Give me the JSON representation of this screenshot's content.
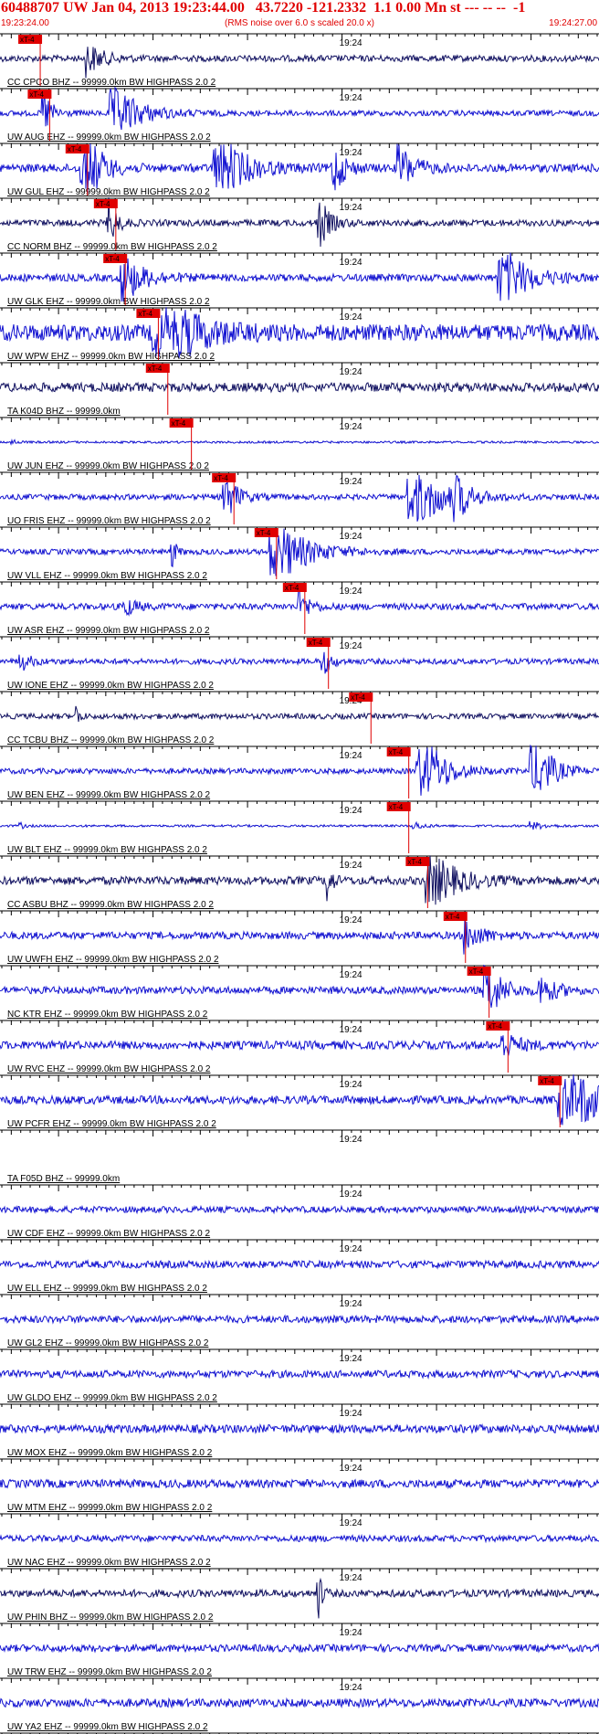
{
  "header": {
    "title": "60488707 UW Jan 04, 2013 19:23:44.00   43.7220 -121.2332  1.1 0.00 Mn st --- -- --  -1",
    "start_time": "19:23:24.00",
    "note": "(RMS noise over 6.0 s scaled 20.0 x)",
    "end_time": "19:24:27.00"
  },
  "chart_data": {
    "type": "line",
    "time_axis": {
      "start": "19:23:24.00",
      "end": "19:24:27.00",
      "tick_label": "19:24"
    },
    "pick_label": "xT-4",
    "series": [
      {
        "name": "CC CPCO BHZ -- 99999.0km BW  HIGHPASS  2.0  2",
        "color": "#101060",
        "amp": 0.35,
        "pick": "19:23:27.0",
        "events": [
          [
            "19:23:33.0",
            1.3,
            1.5
          ]
        ]
      },
      {
        "name": "UW AUG EHZ -- 99999.0km BW  HIGHPASS  2.0  2",
        "color": "#1010d0",
        "amp": 0.3,
        "pick": "19:23:28.0",
        "events": [
          [
            "19:23:28.2",
            3.0,
            0.8
          ],
          [
            "19:23:35.5",
            3.0,
            2.5
          ]
        ]
      },
      {
        "name": "UW GUL EHZ -- 99999.0km BW  HIGHPASS  2.0  2",
        "color": "#1010d0",
        "amp": 0.45,
        "pick": "19:23:32.0",
        "events": [
          [
            "19:23:32.5",
            3.2,
            1.5
          ],
          [
            "19:23:46.5",
            2.5,
            2.5
          ],
          [
            "19:23:59.0",
            2.0,
            1.0
          ],
          [
            "19:24:06.0",
            1.5,
            1.5
          ]
        ]
      },
      {
        "name": "CC NORM BHZ -- 99999.0km BW  HIGHPASS  2.0  2",
        "color": "#101060",
        "amp": 0.35,
        "pick": "19:23:35.0",
        "events": [
          [
            "19:23:35.3",
            1.8,
            0.8
          ],
          [
            "19:23:57.5",
            2.2,
            1.0
          ]
        ]
      },
      {
        "name": "UW GLK EHZ -- 99999.0km BW  HIGHPASS  2.0  2",
        "color": "#1010d0",
        "amp": 0.4,
        "pick": "19:23:36.0",
        "events": [
          [
            "19:23:36.5",
            2.0,
            2.0
          ],
          [
            "19:24:16.5",
            2.5,
            2.5
          ]
        ]
      },
      {
        "name": "UW WPW EHZ -- 99999.0km BW  HIGHPASS  2.0  2",
        "color": "#1010d0",
        "amp": 0.9,
        "pick": "19:23:39.5",
        "events": [
          [
            "19:23:40.0",
            1.8,
            3.0
          ]
        ]
      },
      {
        "name": "TA K04D BHZ -- 99999.0km",
        "color": "#101060",
        "amp": 0.5,
        "pick": "19:23:40.5",
        "events": []
      },
      {
        "name": "UW JUN EHZ -- 99999.0km BW  HIGHPASS  2.0  2",
        "color": "#1010d0",
        "amp": 0.12,
        "pick": "19:23:43.0",
        "events": [
          [
            "19:23:25.0",
            0.6,
            0.6
          ]
        ]
      },
      {
        "name": "UO FRIS EHZ -- 99999.0km BW  HIGHPASS  2.0  2",
        "color": "#1010d0",
        "amp": 0.3,
        "pick": "19:23:47.5",
        "events": [
          [
            "19:23:47.5",
            2.5,
            1.2
          ],
          [
            "19:24:07.0",
            3.8,
            3.0
          ],
          [
            "19:24:12.0",
            2.5,
            1.5
          ]
        ]
      },
      {
        "name": "UW VLL EHZ -- 99999.0km BW  HIGHPASS  2.0  2",
        "color": "#1010d0",
        "amp": 0.3,
        "pick": "19:23:52.0",
        "events": [
          [
            "19:23:52.5",
            3.5,
            3.0
          ],
          [
            "19:23:42.0",
            1.5,
            0.4
          ]
        ]
      },
      {
        "name": "UW ASR EHZ -- 99999.0km BW  HIGHPASS  2.0  2",
        "color": "#1010d0",
        "amp": 0.35,
        "pick": "19:23:55.0",
        "events": [
          [
            "19:23:55.5",
            1.2,
            1.0
          ],
          [
            "19:23:37.0",
            0.8,
            1.0
          ]
        ]
      },
      {
        "name": "UW IONE EHZ -- 99999.0km BW  HIGHPASS  2.0  2",
        "color": "#1010d0",
        "amp": 0.3,
        "pick": "19:23:57.5",
        "events": [
          [
            "19:23:58.0",
            1.2,
            0.8
          ],
          [
            "19:23:26.0",
            0.8,
            1.0
          ]
        ]
      },
      {
        "name": "CC TCBU BHZ -- 99999.0km BW  HIGHPASS  2.0  2",
        "color": "#101060",
        "amp": 0.3,
        "pick": "19:24:02.0",
        "events": [
          [
            "19:23:32.0",
            1.0,
            0.3
          ]
        ]
      },
      {
        "name": "UW BEN EHZ -- 99999.0km BW  HIGHPASS  2.0  2",
        "color": "#1010d0",
        "amp": 0.3,
        "pick": "19:24:06.0",
        "events": [
          [
            "19:24:08.0",
            5.0,
            2.0
          ],
          [
            "19:24:20.0",
            5.0,
            1.5
          ]
        ]
      },
      {
        "name": "UW BLT EHZ -- 99999.0km BW  HIGHPASS  2.0  2",
        "color": "#1010d0",
        "amp": 0.12,
        "pick": "19:24:06.0",
        "events": [
          [
            "19:24:07.5",
            1.0,
            1.0
          ],
          [
            "19:24:20.0",
            0.9,
            1.5
          ],
          [
            "19:23:26.0",
            0.6,
            0.5
          ]
        ]
      },
      {
        "name": "CC ASBU BHZ -- 99999.0km BW  HIGHPASS  2.0  2",
        "color": "#101060",
        "amp": 0.45,
        "pick": "19:24:08.0",
        "events": [
          [
            "19:24:09.0",
            2.0,
            2.5
          ],
          [
            "19:23:58.5",
            1.5,
            0.4
          ]
        ]
      },
      {
        "name": "UW UWFH EHZ -- 99999.0km BW  HIGHPASS  2.0  2",
        "color": "#1010d0",
        "amp": 0.4,
        "pick": "19:24:12.0",
        "events": [
          [
            "19:24:13.0",
            1.2,
            1.5
          ]
        ]
      },
      {
        "name": "NC KTR EHZ -- 99999.0km BW  HIGHPASS  2.0  2",
        "color": "#1010d0",
        "amp": 0.4,
        "pick": "19:24:14.5",
        "events": [
          [
            "19:24:15.0",
            2.5,
            1.5
          ],
          [
            "19:24:21.0",
            1.0,
            1.5
          ]
        ]
      },
      {
        "name": "UW RVC EHZ -- 99999.0km BW  HIGHPASS  2.0  2",
        "color": "#1010d0",
        "amp": 0.45,
        "pick": "19:24:16.5",
        "events": [
          [
            "19:24:17.0",
            0.8,
            1.5
          ]
        ]
      },
      {
        "name": "UW PCFR EHZ -- 99999.0km BW  HIGHPASS  2.0  2",
        "color": "#1010d0",
        "amp": 0.45,
        "pick": "19:24:22.0",
        "events": [
          [
            "19:24:23.0",
            3.2,
            3.0
          ]
        ]
      },
      {
        "name": "TA F05D BHZ -- 99999.0km",
        "color": "#101060",
        "amp": 0,
        "pick": null,
        "events": []
      },
      {
        "name": "UW CDF EHZ -- 99999.0km BW  HIGHPASS  2.0  2",
        "color": "#1010d0",
        "amp": 0.35,
        "pick": null,
        "events": []
      },
      {
        "name": "UW ELL EHZ -- 99999.0km BW  HIGHPASS  2.0  2",
        "color": "#1010d0",
        "amp": 0.4,
        "pick": null,
        "events": []
      },
      {
        "name": "UW GL2 EHZ -- 99999.0km BW  HIGHPASS  2.0  2",
        "color": "#1010d0",
        "amp": 0.4,
        "pick": null,
        "events": []
      },
      {
        "name": "UW GLDO EHZ -- 99999.0km BW  HIGHPASS  2.0  2",
        "color": "#1010d0",
        "amp": 0.4,
        "pick": null,
        "events": []
      },
      {
        "name": "UW MOX EHZ -- 99999.0km BW  HIGHPASS  2.0  2",
        "color": "#1010d0",
        "amp": 0.45,
        "pick": null,
        "events": []
      },
      {
        "name": "UW MTM EHZ -- 99999.0km BW  HIGHPASS  2.0  2",
        "color": "#1010d0",
        "amp": 0.45,
        "pick": null,
        "events": []
      },
      {
        "name": "UW NAC EHZ -- 99999.0km BW  HIGHPASS  2.0  2",
        "color": "#1010d0",
        "amp": 0.35,
        "pick": null,
        "events": []
      },
      {
        "name": "UW PHIN BHZ -- 99999.0km BW  HIGHPASS  2.0  2",
        "color": "#101060",
        "amp": 0.4,
        "pick": null,
        "events": [
          [
            "19:23:57.5",
            2.5,
            0.3
          ]
        ]
      },
      {
        "name": "UW TRW EHZ -- 99999.0km BW  HIGHPASS  2.0  2",
        "color": "#1010d0",
        "amp": 0.4,
        "pick": null,
        "events": []
      },
      {
        "name": "UW YA2 EHZ -- 99999.0km BW  HIGHPASS  2.0  2",
        "color": "#1010d0",
        "amp": 0.45,
        "pick": null,
        "events": []
      },
      {
        "name": "",
        "color": "#1010d0",
        "amp": 0.5,
        "pick": null,
        "events": []
      }
    ]
  }
}
